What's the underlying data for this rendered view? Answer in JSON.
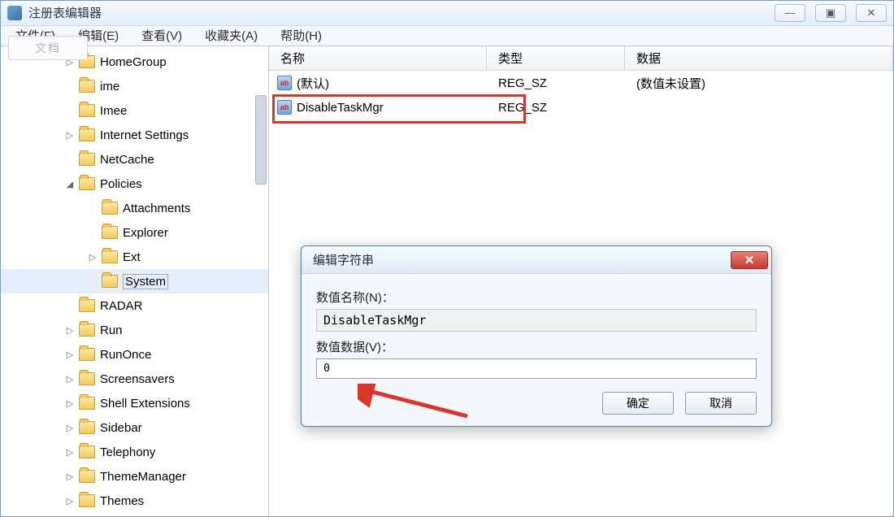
{
  "window": {
    "title": "注册表编辑器"
  },
  "menu": {
    "file": "文件(F)",
    "edit": "编辑(E)",
    "view": "查看(V)",
    "favorites": "收藏夹(A)",
    "help": "帮助(H)"
  },
  "watermark": "文档",
  "tree": {
    "items": [
      {
        "label": "HomeGroup",
        "depth": 1,
        "expander": "▷"
      },
      {
        "label": "ime",
        "depth": 1,
        "expander": ""
      },
      {
        "label": "Imee",
        "depth": 1,
        "expander": ""
      },
      {
        "label": "Internet Settings",
        "depth": 1,
        "expander": "▷"
      },
      {
        "label": "NetCache",
        "depth": 1,
        "expander": ""
      },
      {
        "label": "Policies",
        "depth": 1,
        "expander": "◢"
      },
      {
        "label": "Attachments",
        "depth": 2,
        "expander": ""
      },
      {
        "label": "Explorer",
        "depth": 2,
        "expander": ""
      },
      {
        "label": "Ext",
        "depth": 2,
        "expander": "▷"
      },
      {
        "label": "System",
        "depth": 2,
        "expander": "",
        "selected": true
      },
      {
        "label": "RADAR",
        "depth": 1,
        "expander": ""
      },
      {
        "label": "Run",
        "depth": 1,
        "expander": "▷"
      },
      {
        "label": "RunOnce",
        "depth": 1,
        "expander": "▷"
      },
      {
        "label": "Screensavers",
        "depth": 1,
        "expander": "▷"
      },
      {
        "label": "Shell Extensions",
        "depth": 1,
        "expander": "▷"
      },
      {
        "label": "Sidebar",
        "depth": 1,
        "expander": "▷"
      },
      {
        "label": "Telephony",
        "depth": 1,
        "expander": "▷"
      },
      {
        "label": "ThemeManager",
        "depth": 1,
        "expander": "▷"
      },
      {
        "label": "Themes",
        "depth": 1,
        "expander": "▷"
      }
    ]
  },
  "columns": {
    "name": "名称",
    "type": "类型",
    "data": "数据"
  },
  "values": {
    "row0": {
      "name": "(默认)",
      "type": "REG_SZ",
      "data": "(数值未设置)"
    },
    "row1": {
      "name": "DisableTaskMgr",
      "type": "REG_SZ",
      "data": ""
    }
  },
  "dialog": {
    "title": "编辑字符串",
    "name_label": "数值名称(N)：",
    "name_value": "DisableTaskMgr",
    "data_label": "数值数据(V)：",
    "data_value": "0",
    "ok": "确定",
    "cancel": "取消"
  }
}
